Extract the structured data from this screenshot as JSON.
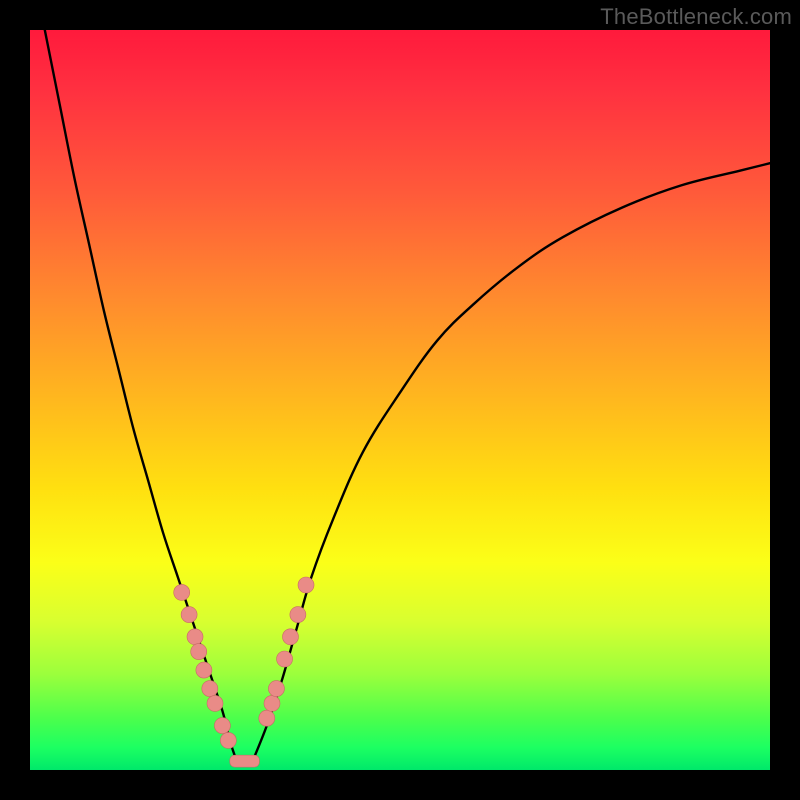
{
  "watermark": "TheBottleneck.com",
  "colors": {
    "dot_fill": "#e98b87",
    "dot_stroke": "#c96a66",
    "curve_stroke": "#000000",
    "gradient_top": "#ff1a3c",
    "gradient_bottom": "#00e86a",
    "frame": "#000000"
  },
  "chart_data": {
    "type": "line",
    "title": "",
    "xlabel": "",
    "ylabel": "",
    "xlim": [
      0,
      100
    ],
    "ylim": [
      0,
      100
    ],
    "grid": false,
    "legend": false,
    "series": [
      {
        "name": "left-curve",
        "note": "sharp descending curve from top-left toward minimum near x≈28",
        "x": [
          2,
          4,
          6,
          8,
          10,
          12,
          14,
          16,
          18,
          20,
          22,
          24,
          26,
          27,
          28
        ],
        "y": [
          100,
          90,
          80,
          71,
          62,
          54,
          46,
          39,
          32,
          26,
          20,
          14,
          8,
          4,
          1
        ]
      },
      {
        "name": "right-curve",
        "note": "rising concave curve from minimum near x≈30 toward upper right, asymptoting near y≈82",
        "x": [
          30,
          32,
          34,
          36,
          38,
          41,
          45,
          50,
          55,
          60,
          66,
          72,
          80,
          88,
          96,
          100
        ],
        "y": [
          1,
          6,
          12,
          19,
          26,
          34,
          43,
          51,
          58,
          63,
          68,
          72,
          76,
          79,
          81,
          82
        ]
      }
    ],
    "markers": {
      "name": "highlighted-points",
      "note": "salmon dots clustered near the V-bottom on both curves, plus a short flat bar at the minimum",
      "left_points": [
        {
          "x": 20.5,
          "y": 24
        },
        {
          "x": 21.5,
          "y": 21
        },
        {
          "x": 22.3,
          "y": 18
        },
        {
          "x": 22.8,
          "y": 16
        },
        {
          "x": 23.5,
          "y": 13.5
        },
        {
          "x": 24.3,
          "y": 11
        },
        {
          "x": 25.0,
          "y": 9
        },
        {
          "x": 26.0,
          "y": 6
        },
        {
          "x": 26.8,
          "y": 4
        }
      ],
      "right_points": [
        {
          "x": 32.0,
          "y": 7
        },
        {
          "x": 32.7,
          "y": 9
        },
        {
          "x": 33.3,
          "y": 11
        },
        {
          "x": 34.4,
          "y": 15
        },
        {
          "x": 35.2,
          "y": 18
        },
        {
          "x": 36.2,
          "y": 21
        },
        {
          "x": 37.3,
          "y": 25
        }
      ],
      "bottom_bar": {
        "x0": 27.0,
        "x1": 31.0,
        "y": 1.2
      }
    }
  }
}
